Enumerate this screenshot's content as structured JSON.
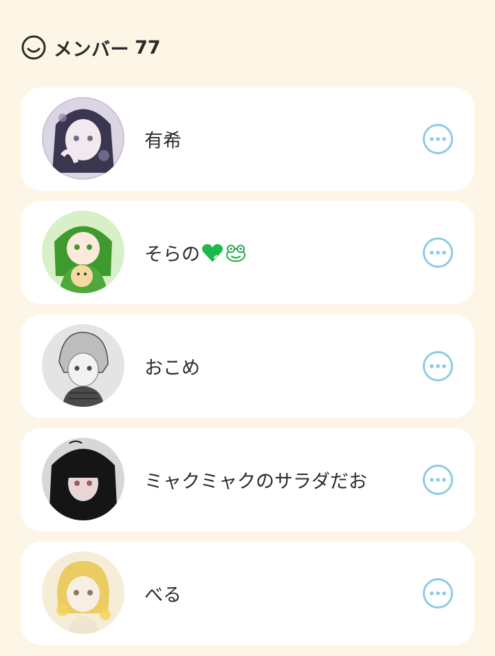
{
  "header": {
    "icon": "smile-icon",
    "title": "メンバー",
    "count": "77"
  },
  "members": [
    {
      "name": "有希",
      "avatar_palette": [
        "#c9c2d6",
        "#3b3650",
        "#f2e9ee"
      ]
    },
    {
      "name": "そらの",
      "emoji_icons": [
        "green-heart-icon",
        "frog-icon"
      ],
      "avatar_palette": [
        "#d8f0c8",
        "#3f9a2e",
        "#f4d9a0"
      ]
    },
    {
      "name": "おこめ",
      "avatar_palette": [
        "#e4e4e4",
        "#4a4a4a",
        "#f2f2f2"
      ]
    },
    {
      "name": "ミャクミャクのサラダだお",
      "avatar_palette": [
        "#d8d6d6",
        "#151515",
        "#e9d6d6"
      ]
    },
    {
      "name": "べる",
      "avatar_palette": [
        "#f5edd7",
        "#e8c64e",
        "#f7efe6"
      ]
    }
  ],
  "colors": {
    "background": "#fdf6e6",
    "card": "#ffffff",
    "more_button": "#8ccbe6",
    "heart": "#1fb84a",
    "frog": "#22a84a"
  },
  "more_button_icon": "more-horizontal-circle-icon"
}
